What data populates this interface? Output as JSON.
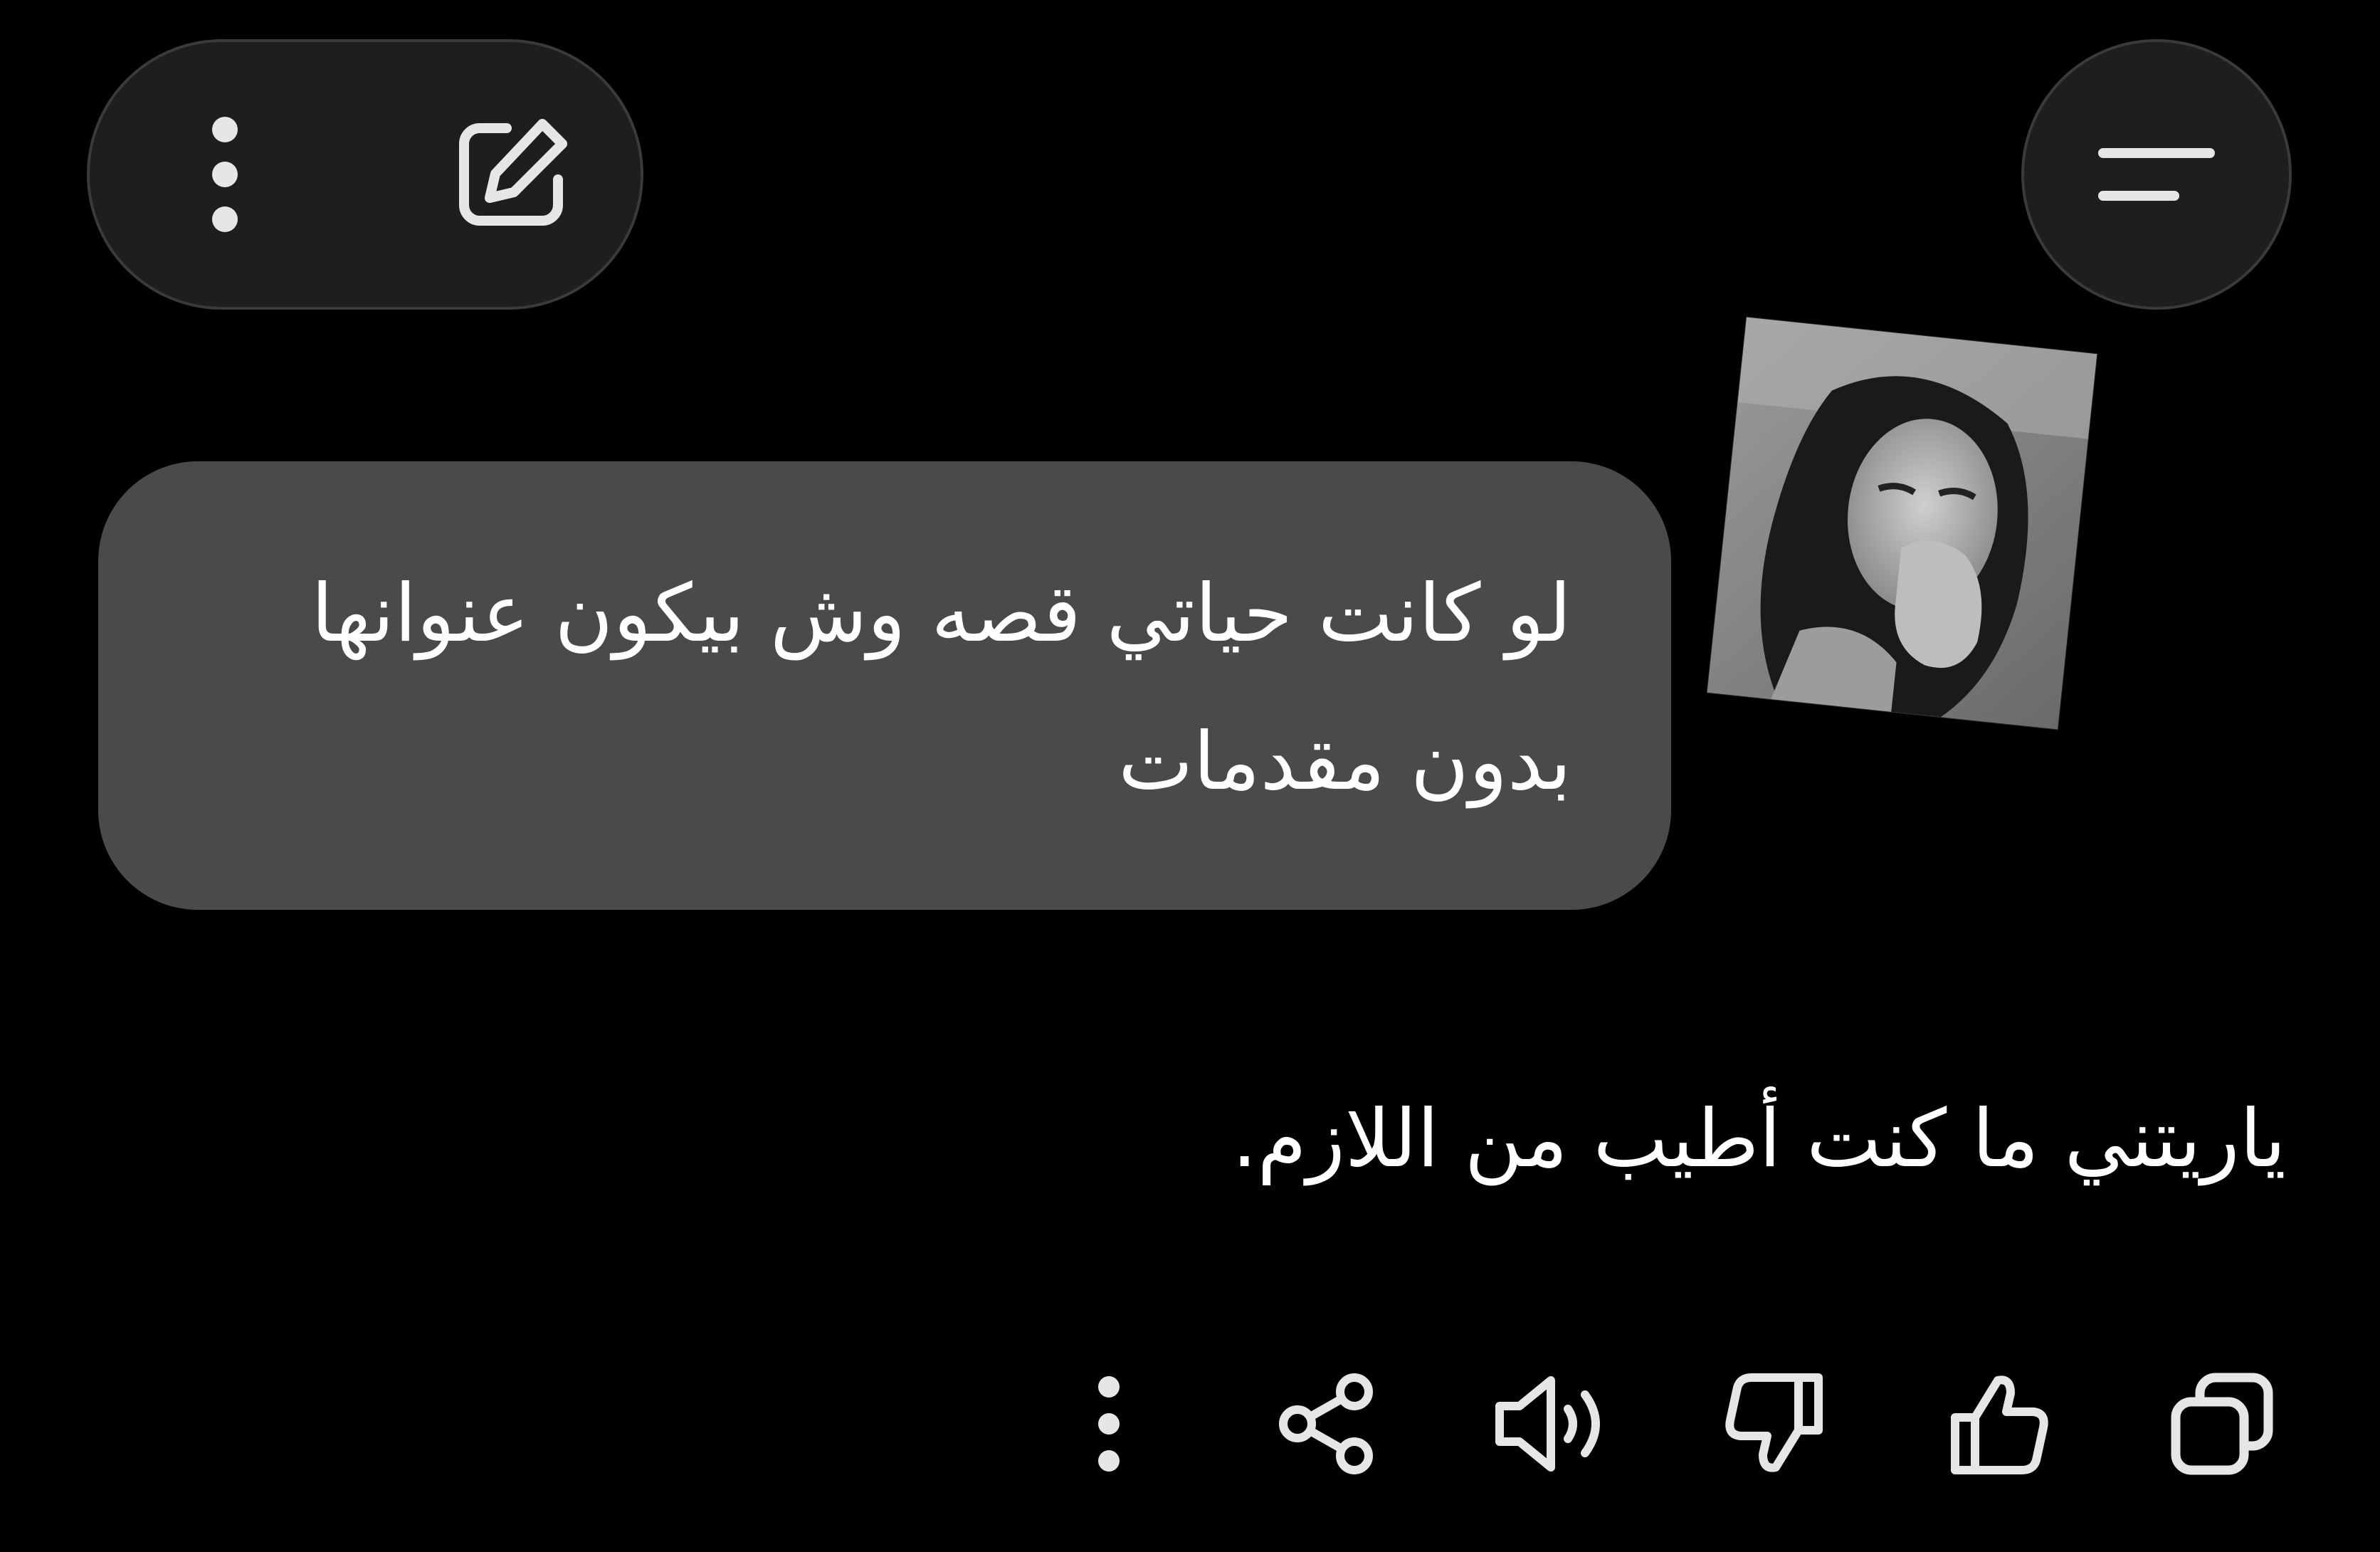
{
  "top_bar": {
    "more_icon": "more-vertical-icon",
    "edit_icon": "edit-icon",
    "menu_icon": "menu-icon"
  },
  "conversation": {
    "attachment_icon": "photo-attachment",
    "user_message": "لو كانت حياتي قصه وش بيكون عنوانها\nبدون مقدمات",
    "assistant_message": "ياريتني ما كنت أطيب من اللازم."
  },
  "actions": {
    "items": [
      {
        "icon": "copy-icon"
      },
      {
        "icon": "thumbs-up-icon"
      },
      {
        "icon": "thumbs-down-icon"
      },
      {
        "icon": "speaker-icon"
      },
      {
        "icon": "share-icon"
      },
      {
        "icon": "more-vertical-icon"
      }
    ]
  },
  "colors": {
    "background": "#000000",
    "bubble": "#4a4a4a",
    "pill": "#1e1e1e",
    "icon": "#e6e6e6"
  }
}
